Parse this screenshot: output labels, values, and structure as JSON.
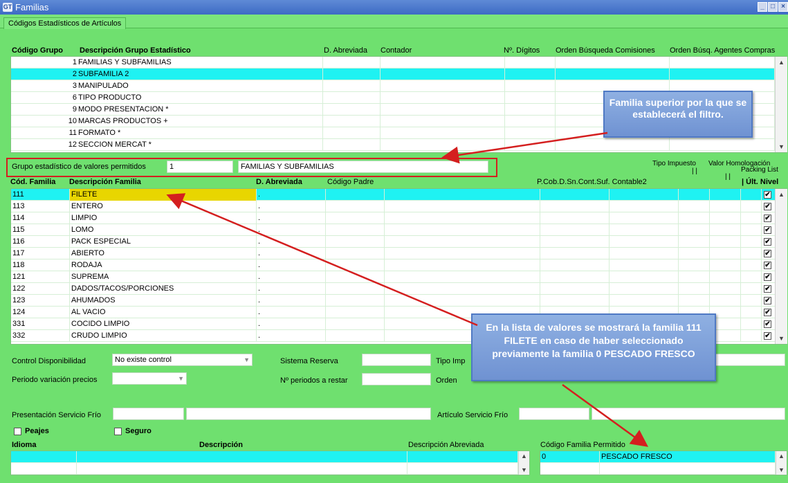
{
  "window": {
    "title": "Familias",
    "app_icon": "GT"
  },
  "tab": {
    "label": "Códigos Estadísticos de Artículos"
  },
  "groups": {
    "headers": [
      "Código Grupo",
      "Descripción Grupo Estadístico",
      "D. Abreviada",
      "Contador",
      "Nº. Dígitos",
      "Orden Búsqueda Comisiones",
      "Orden Búsq. Agentes Compras"
    ],
    "rows": [
      {
        "code": "1",
        "desc": "FAMILIAS Y SUBFAMILIAS"
      },
      {
        "code": "2",
        "desc": "SUBFAMILIA 2"
      },
      {
        "code": "3",
        "desc": "MANIPULADO"
      },
      {
        "code": "6",
        "desc": "TIPO PRODUCTO"
      },
      {
        "code": "9",
        "desc": "MODO PRESENTACION *"
      },
      {
        "code": "10",
        "desc": "MARCAS PRODUCTOS +"
      },
      {
        "code": "11",
        "desc": "FORMATO *"
      },
      {
        "code": "12",
        "desc": "SECCION MERCAT *"
      }
    ],
    "selected_index": 1
  },
  "filter": {
    "label": "Grupo estadístico de valores permitidos",
    "code": "1",
    "desc": "FAMILIAS Y SUBFAMILIAS"
  },
  "families_meta": {
    "tipo_impuesto": "Tipo Impuesto",
    "valor_homologacion": "Valor Homologación",
    "packing_list": "Packing List",
    "bars": "| |"
  },
  "families": {
    "headers": [
      "Cód. Familia",
      "Descripción Familia",
      "D. Abreviada",
      "Código Padre",
      "P.Cob.D.Sn.Cont.Suf. Contable2",
      "| Últ. Nivel"
    ],
    "rows": [
      {
        "code": "111",
        "desc": "FILETE",
        "abbr": "."
      },
      {
        "code": "113",
        "desc": "ENTERO",
        "abbr": "."
      },
      {
        "code": "114",
        "desc": "LIMPIO",
        "abbr": "."
      },
      {
        "code": "115",
        "desc": "LOMO",
        "abbr": "."
      },
      {
        "code": "116",
        "desc": "PACK ESPECIAL",
        "abbr": "."
      },
      {
        "code": "117",
        "desc": "ABIERTO",
        "abbr": "."
      },
      {
        "code": "118",
        "desc": "RODAJA",
        "abbr": "."
      },
      {
        "code": "121",
        "desc": "SUPREMA",
        "abbr": "."
      },
      {
        "code": "122",
        "desc": "DADOS/TACOS/PORCIONES",
        "abbr": "."
      },
      {
        "code": "123",
        "desc": "AHUMADOS",
        "abbr": "."
      },
      {
        "code": "124",
        "desc": "AL VACIO",
        "abbr": "."
      },
      {
        "code": "331",
        "desc": "COCIDO LIMPIO",
        "abbr": "."
      },
      {
        "code": "332",
        "desc": "CRUDO LIMPIO",
        "abbr": "."
      }
    ],
    "check_mark": "✔"
  },
  "form": {
    "control_disponibilidad_label": "Control Disponibilidad",
    "control_disponibilidad_value": "No existe control",
    "periodo_variacion_label": "Periodo variación precios",
    "sistema_reserva_label": "Sistema Reserva",
    "n_periodos_label": "Nº periodos a restar",
    "tipo_imp_label": "Tipo Imp",
    "orden_label": "Orden",
    "presentacion_label": "Presentación Servicio Frío",
    "articulo_label": "Artículo Servicio Frío",
    "peajes_label": "Peajes",
    "seguro_label": "Seguro"
  },
  "idiomas": {
    "headers": [
      "Idioma",
      "Descripción",
      "Descripción Abreviada"
    ]
  },
  "permitidos": {
    "header": "Código Familia Permitido",
    "code": "0",
    "desc": "PESCADO FRESCO"
  },
  "callouts": {
    "top": "Familia superior por la que se establecerá el filtro.",
    "bottom": "En la lista de valores se mostrará la familia 111 FILETE en caso de haber seleccionado previamente la familia 0 PESCADO FRESCO"
  },
  "colors": {
    "background": "#6fe06f",
    "selection": "#1ff2f2",
    "highlight_cell": "#e8d600",
    "annotation_red": "#d41f1f",
    "callout_blue": "#7fa2dc"
  }
}
